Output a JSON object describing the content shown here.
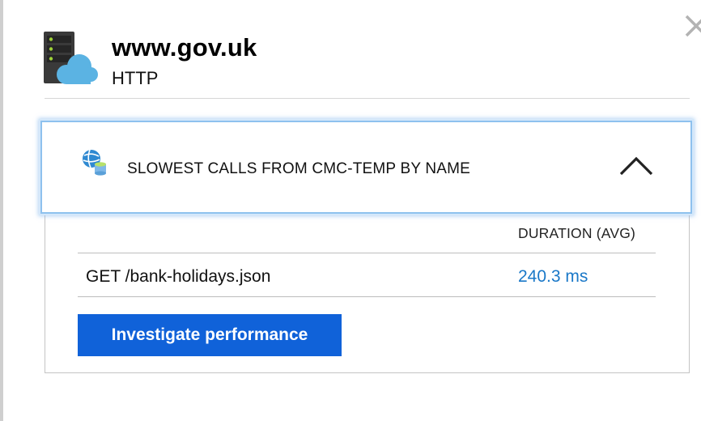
{
  "header": {
    "title": "www.gov.uk",
    "subtitle": "HTTP",
    "icon": "server-cloud-icon"
  },
  "section": {
    "title": "SLOWEST CALLS FROM CMC-TEMP BY NAME",
    "icon": "app-insights-icon",
    "expanded": true,
    "column_header": "DURATION (AVG)"
  },
  "calls": [
    {
      "name": "GET /bank-holidays.json",
      "duration": "240.3 ms"
    }
  ],
  "actions": {
    "investigate_label": "Investigate performance"
  },
  "colors": {
    "accent": "#1062d9",
    "link": "#1a78c8",
    "focus_ring": "#8ec1ee",
    "cloud": "#4aa3d8"
  }
}
